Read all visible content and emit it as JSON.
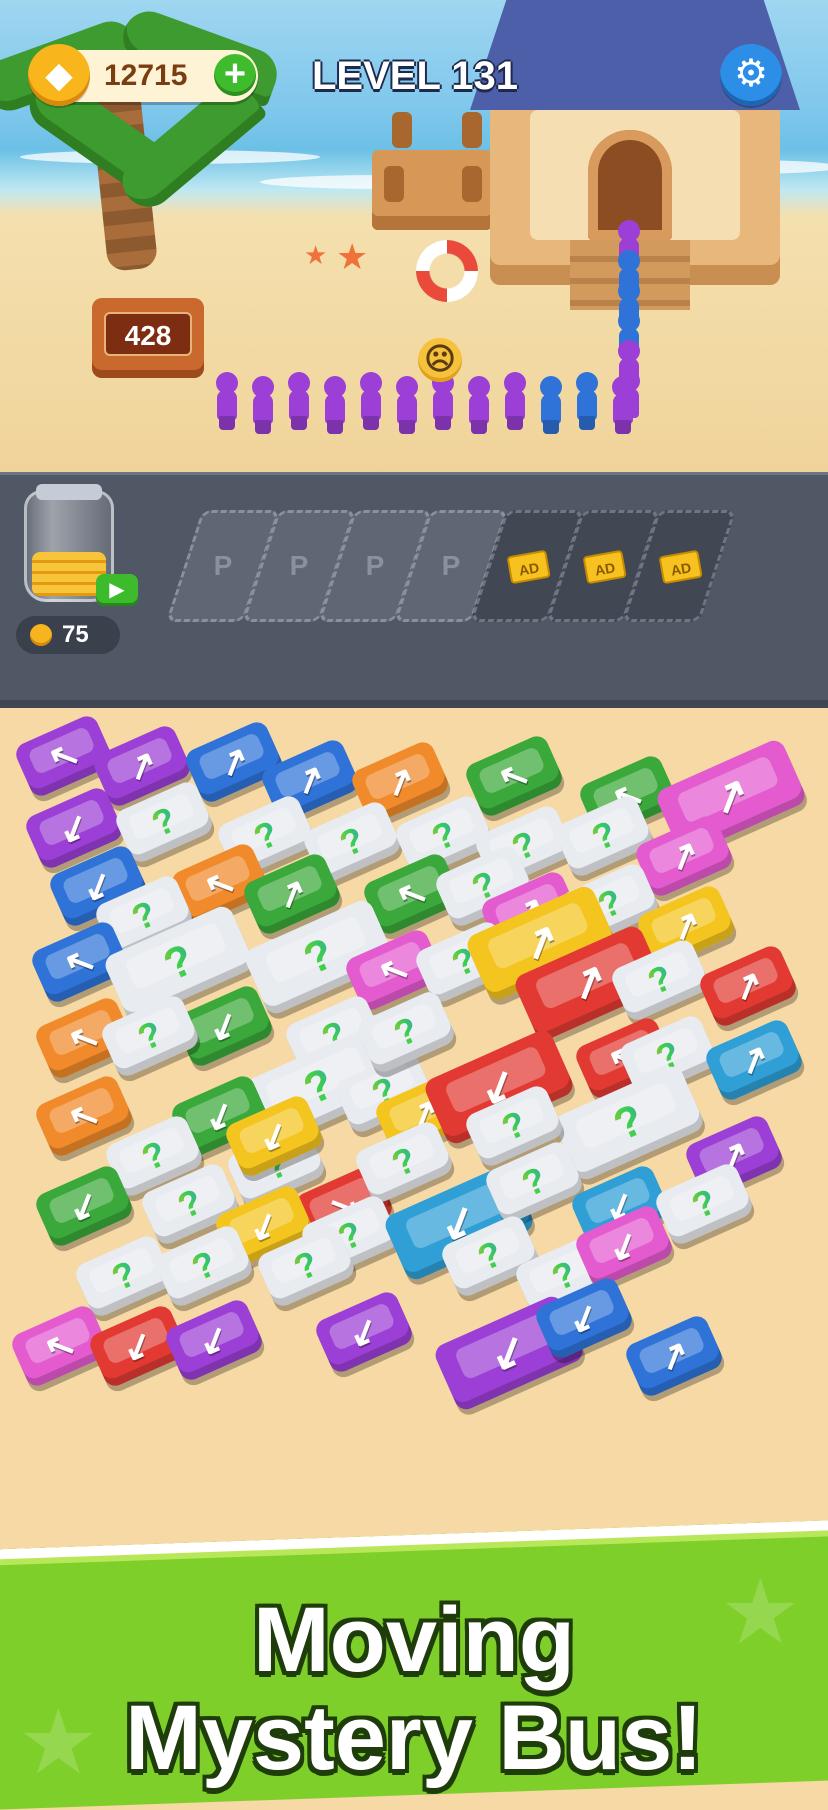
{
  "hud": {
    "coins": "12715",
    "plus": "+",
    "level": "LEVEL 131",
    "coin_glyph": "◆",
    "settings_glyph": "⚙"
  },
  "scene": {
    "passenger_count": "428",
    "emoji_glyph": "☹",
    "passenger_colors": [
      "purple",
      "purple",
      "purple",
      "purple",
      "purple",
      "purple",
      "purple",
      "purple",
      "purple",
      "blue",
      "blue",
      "purple"
    ],
    "stair_queue_colors": [
      "purple",
      "blue",
      "blue",
      "blue",
      "purple",
      "purple"
    ]
  },
  "parking": {
    "jar_coins": "75",
    "play_glyph": "▶",
    "slots": [
      {
        "label": "P",
        "state": "open"
      },
      {
        "label": "P",
        "state": "open"
      },
      {
        "label": "P",
        "state": "open"
      },
      {
        "label": "P",
        "state": "open"
      },
      {
        "label": "AD",
        "state": "locked"
      },
      {
        "label": "AD",
        "state": "locked"
      },
      {
        "label": "AD",
        "state": "locked"
      }
    ]
  },
  "colors": {
    "purple": "#9b3fd6",
    "blue": "#2f73d8",
    "orange": "#f08a2a",
    "green": "#3aa83a",
    "pink": "#e45bd0",
    "yellow": "#f4c51f",
    "red": "#e23a32",
    "white": "#e8ebf0",
    "cyan": "#2f9fd6"
  },
  "vehicles": [
    {
      "color": "purple",
      "kind": "car",
      "dir": "↖"
    },
    {
      "color": "purple",
      "kind": "car",
      "dir": "↗"
    },
    {
      "color": "blue",
      "kind": "car",
      "dir": "↗"
    },
    {
      "color": "blue",
      "kind": "car",
      "dir": "↗"
    },
    {
      "color": "orange",
      "kind": "car",
      "dir": "↗"
    },
    {
      "color": "green",
      "kind": "car",
      "dir": "↖"
    },
    {
      "color": "green",
      "kind": "car",
      "dir": "↖"
    },
    {
      "color": "pink",
      "kind": "bus",
      "dir": "↗"
    },
    {
      "color": "purple",
      "kind": "car",
      "dir": "↙"
    },
    {
      "color": "white",
      "kind": "car",
      "dir": "?"
    },
    {
      "color": "white",
      "kind": "car",
      "dir": "?"
    },
    {
      "color": "white",
      "kind": "car",
      "dir": "?"
    },
    {
      "color": "white",
      "kind": "car",
      "dir": "?"
    },
    {
      "color": "white",
      "kind": "car",
      "dir": "?"
    },
    {
      "color": "white",
      "kind": "car",
      "dir": "?"
    },
    {
      "color": "pink",
      "kind": "car",
      "dir": "↗"
    },
    {
      "color": "blue",
      "kind": "car",
      "dir": "↙"
    },
    {
      "color": "orange",
      "kind": "car",
      "dir": "↖"
    },
    {
      "color": "white",
      "kind": "car",
      "dir": "?"
    },
    {
      "color": "green",
      "kind": "car",
      "dir": "↗"
    },
    {
      "color": "green",
      "kind": "car",
      "dir": "↖"
    },
    {
      "color": "white",
      "kind": "car",
      "dir": "?"
    },
    {
      "color": "pink",
      "kind": "car",
      "dir": "↗"
    },
    {
      "color": "white",
      "kind": "car",
      "dir": "?"
    },
    {
      "color": "yellow",
      "kind": "car",
      "dir": "↗"
    },
    {
      "color": "blue",
      "kind": "car",
      "dir": "↖"
    },
    {
      "color": "white",
      "kind": "bus",
      "dir": "?"
    },
    {
      "color": "white",
      "kind": "bus",
      "dir": "?"
    },
    {
      "color": "pink",
      "kind": "car",
      "dir": "↖"
    },
    {
      "color": "white",
      "kind": "car",
      "dir": "?"
    },
    {
      "color": "yellow",
      "kind": "bus",
      "dir": "↗"
    },
    {
      "color": "red",
      "kind": "bus",
      "dir": "↗"
    },
    {
      "color": "white",
      "kind": "car",
      "dir": "?"
    },
    {
      "color": "red",
      "kind": "car",
      "dir": "↗"
    },
    {
      "color": "orange",
      "kind": "car",
      "dir": "↖"
    },
    {
      "color": "green",
      "kind": "car",
      "dir": "↙"
    },
    {
      "color": "white",
      "kind": "car",
      "dir": "?"
    },
    {
      "color": "white",
      "kind": "car",
      "dir": "?"
    },
    {
      "color": "white",
      "kind": "bus",
      "dir": "?"
    },
    {
      "color": "white",
      "kind": "car",
      "dir": "?"
    },
    {
      "color": "red",
      "kind": "car",
      "dir": "↖"
    },
    {
      "color": "white",
      "kind": "car",
      "dir": "?"
    },
    {
      "color": "cyan",
      "kind": "car",
      "dir": "↗"
    },
    {
      "color": "white",
      "kind": "car",
      "dir": "?"
    },
    {
      "color": "orange",
      "kind": "car",
      "dir": "↖"
    },
    {
      "color": "green",
      "kind": "car",
      "dir": "↙"
    },
    {
      "color": "yellow",
      "kind": "car",
      "dir": "↗"
    },
    {
      "color": "red",
      "kind": "bus",
      "dir": "↙"
    },
    {
      "color": "white",
      "kind": "bus",
      "dir": "?"
    },
    {
      "color": "white",
      "kind": "car",
      "dir": "?"
    },
    {
      "color": "white",
      "kind": "car",
      "dir": "?"
    },
    {
      "color": "yellow",
      "kind": "car",
      "dir": "↙"
    },
    {
      "color": "white",
      "kind": "car",
      "dir": "?"
    },
    {
      "color": "red",
      "kind": "car",
      "dir": "↘"
    },
    {
      "color": "white",
      "kind": "car",
      "dir": "?"
    },
    {
      "color": "purple",
      "kind": "car",
      "dir": "↗"
    },
    {
      "color": "green",
      "kind": "car",
      "dir": "↙"
    },
    {
      "color": "white",
      "kind": "car",
      "dir": "?"
    },
    {
      "color": "yellow",
      "kind": "car",
      "dir": "↙"
    },
    {
      "color": "white",
      "kind": "car",
      "dir": "?"
    },
    {
      "color": "cyan",
      "kind": "bus",
      "dir": "↙"
    },
    {
      "color": "white",
      "kind": "car",
      "dir": "?"
    },
    {
      "color": "cyan",
      "kind": "car",
      "dir": "↙"
    },
    {
      "color": "white",
      "kind": "car",
      "dir": "?"
    },
    {
      "color": "white",
      "kind": "car",
      "dir": "?"
    },
    {
      "color": "white",
      "kind": "car",
      "dir": "?"
    },
    {
      "color": "white",
      "kind": "car",
      "dir": "?"
    },
    {
      "color": "white",
      "kind": "car",
      "dir": "?"
    },
    {
      "color": "white",
      "kind": "car",
      "dir": "?"
    },
    {
      "color": "pink",
      "kind": "car",
      "dir": "↙"
    },
    {
      "color": "pink",
      "kind": "car",
      "dir": "↖"
    },
    {
      "color": "red",
      "kind": "car",
      "dir": "↙"
    },
    {
      "color": "purple",
      "kind": "car",
      "dir": "↙"
    },
    {
      "color": "purple",
      "kind": "car",
      "dir": "↙"
    },
    {
      "color": "purple",
      "kind": "bus",
      "dir": "↙"
    },
    {
      "color": "blue",
      "kind": "car",
      "dir": "↙"
    },
    {
      "color": "blue",
      "kind": "car",
      "dir": "↗"
    }
  ],
  "banner": {
    "line1": "Moving",
    "line2": "Mystery Bus!"
  }
}
